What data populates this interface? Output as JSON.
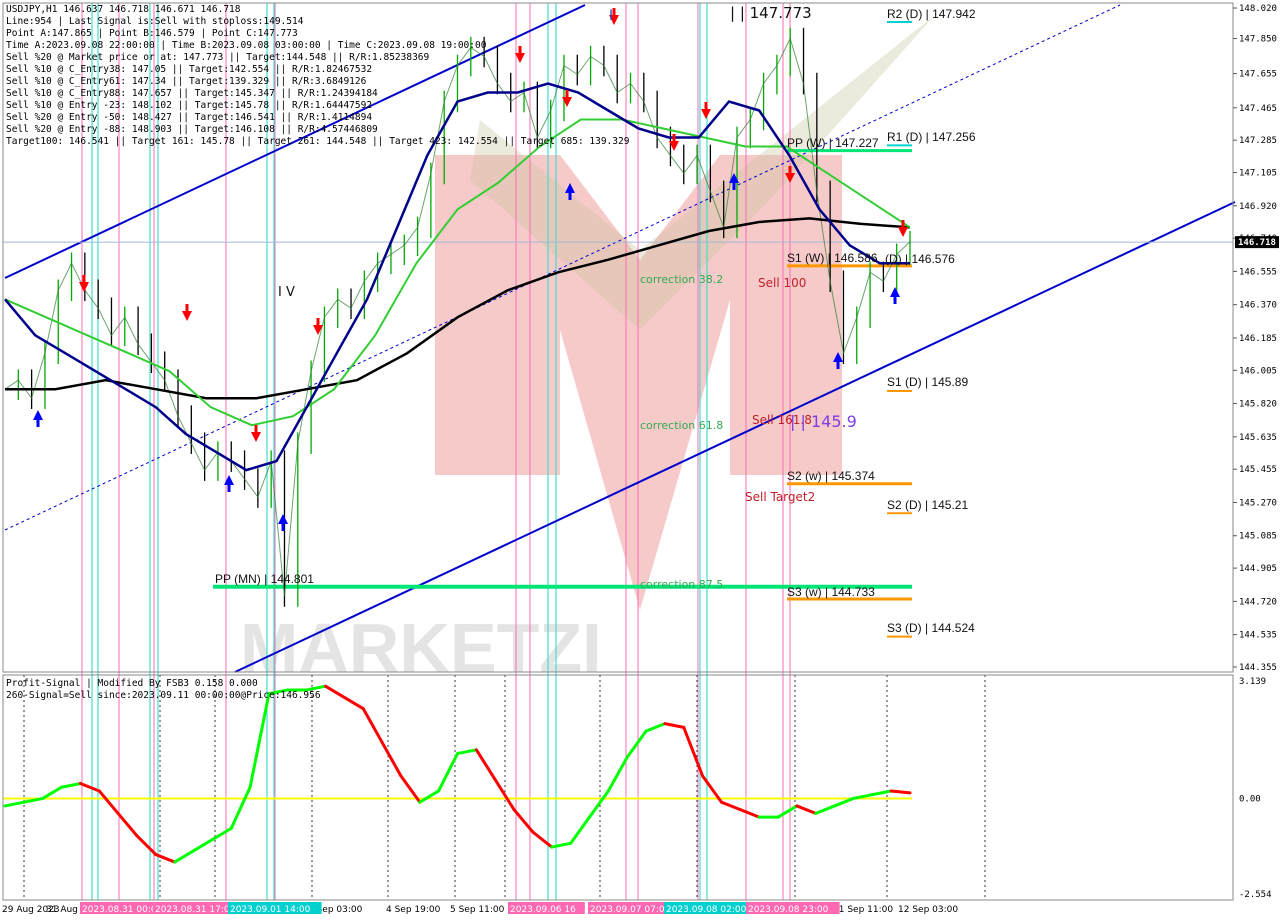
{
  "header": {
    "lines": [
      "USDJPY,H1  146.637 146.718 146.671 146.718",
      "Line:954 | Last Signal is:Sell with stoploss:149.514",
      "Point A:147.865 | Point B:146.579 | Point C:147.773",
      "Time A:2023.09.08 22:00:00 | Time B:2023.09.08 03:00:00 | Time C:2023.09.08 19:00:00",
      "Sell %20 @ Market price or at: 147.773 || Target:144.548 || R/R:1.85238369",
      "Sell %10 @ C_Entry38: 147.05 || Target:142.554 || R/R:1.82467532",
      "Sell %10 @ C_Entry61: 147.34 || Target:139.329 || R/R:3.6849126",
      "Sell %10 @ C_Entry88: 147.657 || Target:145.347 || R/R:1.24394184",
      "Sell %10 @ Entry -23: 148.102 || Target:145.78 || R/R:1.64447592",
      "Sell %20 @ Entry -50: 148.427 || Target:146.541 || R/R:1.4114894",
      "Sell %20 @ Entry -88: 148.903 || Target:146.108 || R/R:4.57446809",
      "Target100: 146.541 || Target 161: 145.78 || Target 261: 144.548 || Target 423: 142.554 || Target 685: 139.329"
    ]
  },
  "price_axis": {
    "ticks": [
      "148.020",
      "147.850",
      "147.655",
      "147.465",
      "147.285",
      "147.105",
      "146.920",
      "146.740",
      "146.555",
      "146.370",
      "146.185",
      "146.005",
      "145.820",
      "145.635",
      "145.455",
      "145.270",
      "145.085",
      "144.905",
      "144.720",
      "144.535",
      "144.355"
    ],
    "current_price": "146.718"
  },
  "time_axis": {
    "labels": [
      "29 Aug 2023",
      "31 Aug 2023",
      "4 Sep 03:00",
      "4 Sep 19:00",
      "5 Sep 11:00",
      "11 Sep 11:00",
      "12 Sep 03:00"
    ],
    "highlight_labels": [
      {
        "text": "2023.08.31 00:00",
        "color": "#ff69b4"
      },
      {
        "text": "2023.08.31 17:00",
        "color": "#ff69b4"
      },
      {
        "text": "2023.09.01 14:00",
        "color": "#00d0d0"
      },
      {
        "text": "2023.09.06 16",
        "color": "#ff69b4"
      },
      {
        "text": "2023.09.07 07:00",
        "color": "#ff69b4"
      },
      {
        "text": "2023.09.08 02:00",
        "color": "#00d0d0"
      },
      {
        "text": "2023.09.08 23:00",
        "color": "#ff69b4"
      }
    ]
  },
  "levels": [
    {
      "label": "R2 (D) | 147.942",
      "color": "#00d0d0"
    },
    {
      "label": "R1 (D) | 147.256",
      "color": "#00d0d0"
    },
    {
      "label": "PP (W) | 147.227",
      "color": "#00e676"
    },
    {
      "label": "S1 (W) | 146.586",
      "color": "#ff9800"
    },
    {
      "label": "(D) | 146.576",
      "color": "#ff9800"
    },
    {
      "label": "S1 (D) | 145.89",
      "color": "#ff9800"
    },
    {
      "label": "S2 (w) | 145.374",
      "color": "#ff9800"
    },
    {
      "label": "S2 (D) | 145.21",
      "color": "#ff9800"
    },
    {
      "label": "PP (MN) | 144.801",
      "color": "#00e676"
    },
    {
      "label": "S3 (w) | 144.733",
      "color": "#ff9800"
    },
    {
      "label": "S3 (D) | 144.524",
      "color": "#ff9800"
    }
  ],
  "annotations": {
    "wave_iv": "I V",
    "wave_i": "I",
    "point_c_value": "| | 147.773",
    "corr382": "correction 38.2",
    "corr618": "correction 61.8",
    "corr875": "correction 87.5",
    "sell100": "Sell 100",
    "sell1618": "Sell 161.8",
    "value1459": "| | 145.9",
    "sell_target2": "Sell Target2",
    "watermark": "MARKETZI"
  },
  "indicator": {
    "title": "Profit-Signal | Modified By FSB3 0.158 0.000",
    "signal": "260-Signal=Sell since:2023.09.11 00:00:00@Price:146.956",
    "axis": [
      "3.139",
      "0.00",
      "-2.554"
    ]
  },
  "colors": {
    "ma_dark_blue": "#00008b",
    "ma_green": "#32cd32",
    "ma_black": "#000000",
    "channel_blue": "#0000cd",
    "candle_green": "#00aa00",
    "candle_dark": "#000000",
    "signal_green": "#00ff00",
    "signal_red": "#ff0000",
    "zero_line": "#ffff00"
  },
  "chart_data": {
    "type": "line",
    "symbol": "USDJPY",
    "timeframe": "H1",
    "y_range": [
      144.355,
      148.02
    ],
    "price_path": [
      145.9,
      145.95,
      145.85,
      146.1,
      146.45,
      146.6,
      146.45,
      146.35,
      146.2,
      146.3,
      146.15,
      146.05,
      145.95,
      145.75,
      145.6,
      145.45,
      145.55,
      145.5,
      145.4,
      145.3,
      145.5,
      144.75,
      145.6,
      146.0,
      146.3,
      146.4,
      146.35,
      146.5,
      146.6,
      146.65,
      146.7,
      146.8,
      147.1,
      147.5,
      147.7,
      147.8,
      147.75,
      147.6,
      147.5,
      147.55,
      147.3,
      147.45,
      147.7,
      147.65,
      147.75,
      147.7,
      147.55,
      147.6,
      147.5,
      147.3,
      147.2,
      147.1,
      147.2,
      147.0,
      146.8,
      147.3,
      147.4,
      147.6,
      147.7,
      147.85,
      147.6,
      147.0,
      146.5,
      146.1,
      146.3,
      146.55,
      146.5,
      146.65,
      146.72
    ],
    "blue_ma": [
      146.4,
      146.2,
      146.1,
      146.0,
      145.9,
      145.8,
      145.65,
      145.55,
      145.45,
      145.5,
      145.8,
      146.1,
      146.4,
      146.8,
      147.2,
      147.5,
      147.55,
      147.55,
      147.6,
      147.55,
      147.45,
      147.35,
      147.3,
      147.3,
      147.5,
      147.45,
      147.2,
      146.9,
      146.7,
      146.6,
      146.6
    ],
    "green_ma": [
      146.4,
      146.3,
      146.2,
      146.1,
      146.0,
      145.8,
      145.7,
      145.75,
      145.9,
      146.2,
      146.6,
      146.9,
      147.05,
      147.25,
      147.4,
      147.4,
      147.35,
      147.3,
      147.25,
      147.25,
      147.1,
      146.95,
      146.8
    ],
    "black_ma": [
      145.9,
      145.9,
      145.95,
      145.9,
      145.85,
      145.85,
      145.9,
      145.95,
      146.1,
      146.3,
      146.45,
      146.55,
      146.62,
      146.7,
      146.78,
      146.83,
      146.85,
      146.82,
      146.8
    ],
    "signal_series": [
      -0.2,
      -0.1,
      0.0,
      0.3,
      0.4,
      0.2,
      -0.4,
      -1.0,
      -1.5,
      -1.7,
      -1.4,
      -1.1,
      -0.8,
      0.3,
      2.8,
      2.9,
      2.9,
      3.0,
      2.7,
      2.4,
      1.5,
      0.6,
      -0.1,
      0.2,
      1.2,
      1.3,
      0.5,
      -0.3,
      -0.9,
      -1.3,
      -1.2,
      -0.5,
      0.2,
      1.1,
      1.8,
      2.0,
      1.9,
      0.6,
      -0.1,
      -0.3,
      -0.5,
      -0.5,
      -0.2,
      -0.4,
      -0.2,
      0.0,
      0.1,
      0.2,
      0.15
    ]
  }
}
